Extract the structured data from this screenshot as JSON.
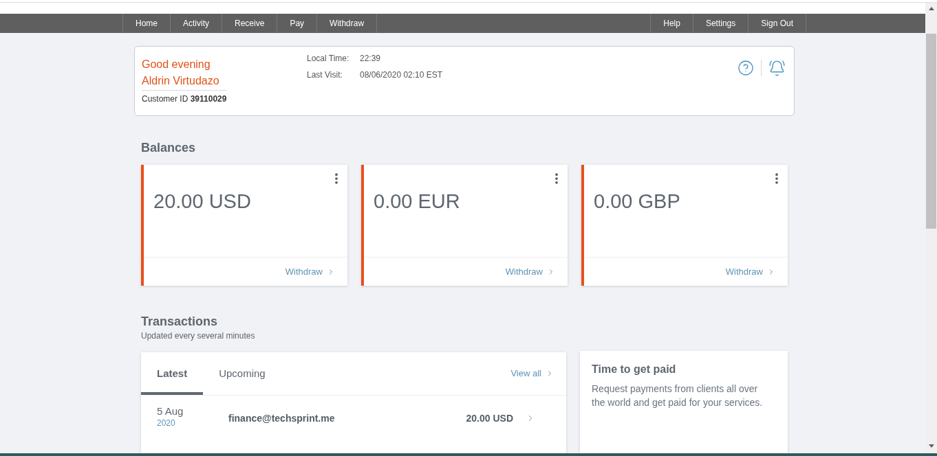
{
  "nav": {
    "left": [
      {
        "label": "Home"
      },
      {
        "label": "Activity"
      },
      {
        "label": "Receive"
      },
      {
        "label": "Pay"
      },
      {
        "label": "Withdraw"
      }
    ],
    "right": [
      {
        "label": "Help"
      },
      {
        "label": "Settings"
      },
      {
        "label": "Sign Out"
      }
    ]
  },
  "greeting": {
    "salutation": "Good evening",
    "name": "Aldrin Virtudazo",
    "customer_id": "Customer ID **39110029**",
    "fields": [
      {
        "label": "Local Time:",
        "value": "22:39"
      },
      {
        "label": "Last Visit:",
        "value": "08/06/2020 02:10 EST"
      }
    ]
  },
  "balances": {
    "title": "Balances",
    "cards": [
      {
        "amount": "20.00 USD",
        "action": "Withdraw"
      },
      {
        "amount": "0.00 EUR",
        "action": "Withdraw"
      },
      {
        "amount": "0.00 GBP",
        "action": "Withdraw"
      }
    ]
  },
  "transactions": {
    "title": "Transactions",
    "subtitle": "Updated every several minutes",
    "tabs": [
      {
        "label": "Latest",
        "selected": true
      },
      {
        "label": "Upcoming",
        "selected": false
      }
    ],
    "view_all": "View all",
    "rows": [
      {
        "day": "5 Aug",
        "year": "2020",
        "party": "finance@techsprint.me",
        "amount": "20.00 USD"
      }
    ]
  },
  "promo": {
    "title": "Time to get paid",
    "text": "Request payments from clients all over the world and get paid for your services."
  }
}
